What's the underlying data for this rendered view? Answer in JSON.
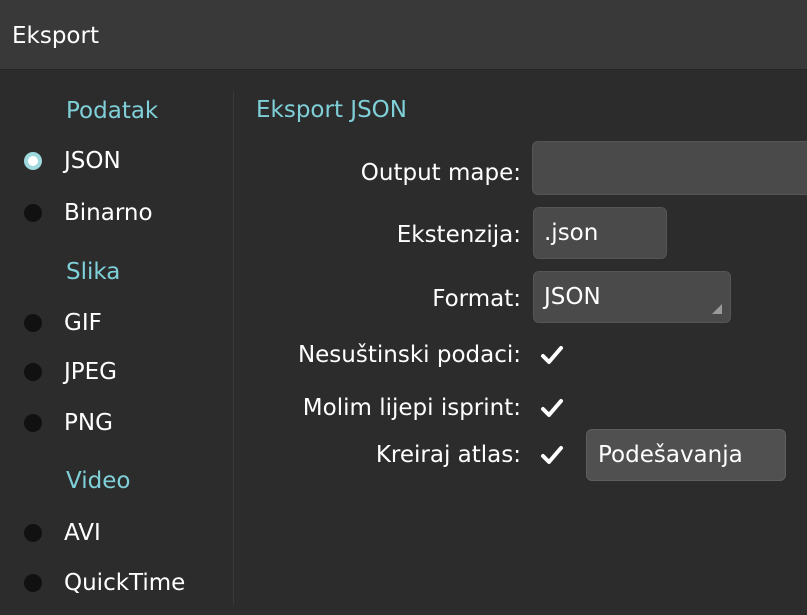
{
  "window": {
    "title": "Eksport"
  },
  "sidebar": {
    "sections": [
      {
        "header": "Podatak",
        "options": [
          {
            "label": "JSON",
            "selected": true
          },
          {
            "label": "Binarno",
            "selected": false
          }
        ]
      },
      {
        "header": "Slika",
        "options": [
          {
            "label": "GIF",
            "selected": false
          },
          {
            "label": "JPEG",
            "selected": false
          },
          {
            "label": "PNG",
            "selected": false
          }
        ]
      },
      {
        "header": "Video",
        "options": [
          {
            "label": "AVI",
            "selected": false
          },
          {
            "label": "QuickTime",
            "selected": false
          }
        ]
      }
    ]
  },
  "panel": {
    "title": "Eksport JSON",
    "output_folder": {
      "label": "Output mape:",
      "value": ""
    },
    "extension": {
      "label": "Ekstenzija:",
      "value": ".json"
    },
    "format": {
      "label": "Format:",
      "value": "JSON"
    },
    "nonessential_data": {
      "label": "Nesuštinski podaci:",
      "checked": true
    },
    "pretty_print": {
      "label": "Molim lijepi isprint:",
      "checked": true
    },
    "create_atlas": {
      "label": "Kreiraj atlas:",
      "checked": true,
      "settings_button": "Podešavanja"
    }
  },
  "colors": {
    "accent": "#7fd0d8",
    "background": "#2c2c2c",
    "titlebar": "#393939",
    "field": "#4a4a4a"
  }
}
